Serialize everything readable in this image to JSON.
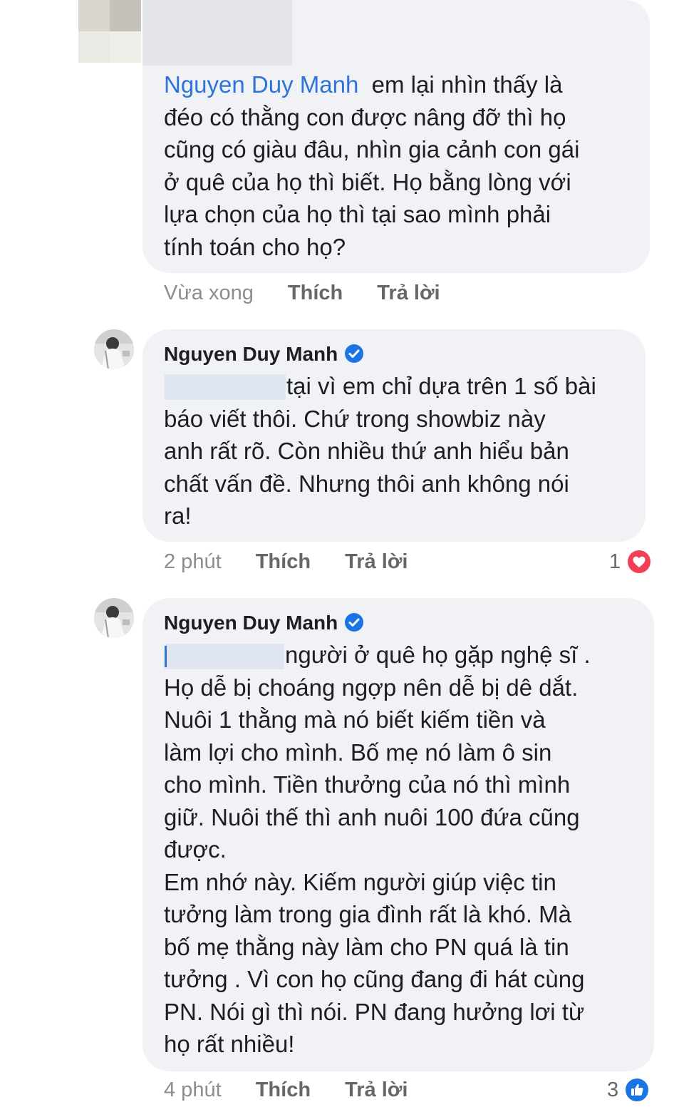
{
  "comments": [
    {
      "mention": "Nguyen Duy Manh",
      "text_after_mention": "em lại nhìn thấy là\nđéo có thằng con được nâng đỡ thì họ\ncũng có giàu đâu, nhìn gia cảnh con gái\nở quê của họ thì biết. Họ bằng lòng với\nlựa chọn của họ thì tại sao mình phải\ntính toán cho họ?",
      "time": "Vừa xong",
      "like_label": "Thích",
      "reply_label": "Trả lời"
    },
    {
      "author": "Nguyen Duy Manh",
      "text_after_mention": "tại vì em chỉ dựa trên 1 số bài\nbáo viết thôi. Chứ trong showbiz này\nanh rất rõ. Còn nhiều thứ anh hiểu bản\nchất vấn đề. Nhưng thôi anh không nói\nra!",
      "time": "2 phút",
      "like_label": "Thích",
      "reply_label": "Trả lời",
      "reaction_count": "1",
      "reaction_type": "love-icon",
      "reaction_color": "#f33e58"
    },
    {
      "author": "Nguyen Duy Manh",
      "text_after_mention": "người ở quê họ gặp nghệ sĩ .\nHọ dễ bị choáng ngợp nên dễ bị dê dắt.\nNuôi 1 thằng mà nó biết kiếm tiền và\nlàm lợi cho mình. Bố mẹ nó làm ô sin\ncho mình. Tiền thưởng của nó thì mình\ngiữ. Nuôi thế thì anh nuôi 100 đứa cũng\nđược.\nEm nhớ này. Kiếm người giúp việc tin\ntưởng làm trong gia đình rất là khó. Mà\nbố mẹ thằng này làm cho PN quá là tin\ntưởng . Vì con họ cũng đang đi hát cùng\nPN. Nói gì thì nói. PN đang hưởng lơi từ\nhọ rất nhiều!",
      "time": "4 phút",
      "like_label": "Thích",
      "reply_label": "Trả lời",
      "reaction_count": "3",
      "reaction_type": "like-icon",
      "reaction_color": "#1b74e4"
    }
  ],
  "colors": {
    "bubble": "#f0f2f5",
    "mention": "#2d74d9",
    "verified": "#1b74e4",
    "meta_text": "#65676b"
  }
}
